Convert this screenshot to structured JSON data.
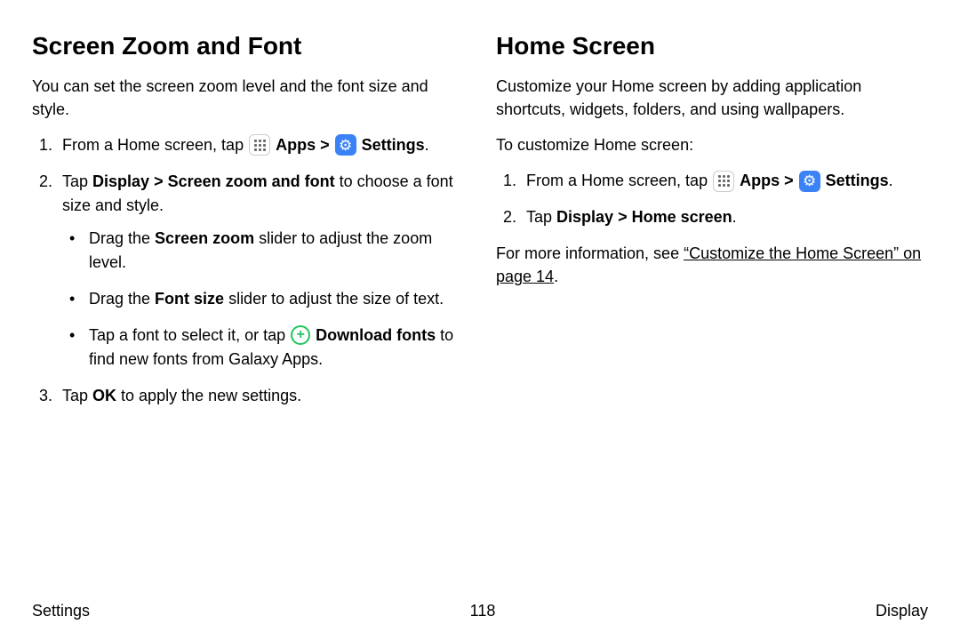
{
  "left": {
    "heading": "Screen Zoom and Font",
    "intro": "You can set the screen zoom level and the font size and style.",
    "step1_a": "From a Home screen, tap ",
    "apps": "Apps",
    "gt": ">",
    "settings": "Settings",
    "period": ".",
    "step2_a": "Tap ",
    "step2_b": "Display",
    "step2_c": " > ",
    "step2_d": "Screen zoom and font",
    "step2_e": " to choose a font size and style.",
    "bullet1_a": "Drag the ",
    "bullet1_b": "Screen zoom",
    "bullet1_c": " slider to adjust the zoom level.",
    "bullet2_a": "Drag the ",
    "bullet2_b": "Font size",
    "bullet2_c": " slider to adjust the size of text.",
    "bullet3_a": "Tap a font to select it, or tap ",
    "bullet3_b": "Download fonts",
    "bullet3_c": " to find new fonts from Galaxy Apps.",
    "step3_a": "Tap ",
    "step3_b": "OK",
    "step3_c": " to apply the new settings."
  },
  "right": {
    "heading": "Home Screen",
    "intro": "Customize your Home screen by adding application shortcuts, widgets, folders, and using wallpapers.",
    "tocustom": "To customize Home screen:",
    "step1_a": "From a Home screen, tap ",
    "apps": "Apps",
    "gt": ">",
    "settings": "Settings",
    "period": ".",
    "step2_a": "Tap ",
    "step2_b": "Display",
    "step2_c": " > ",
    "step2_d": "Home screen",
    "step2_e": ".",
    "more_a": "For more information, see ",
    "more_link": "“Customize the Home Screen” on page 14",
    "more_c": "."
  },
  "footer": {
    "left": "Settings",
    "center": "118",
    "right": "Display"
  }
}
